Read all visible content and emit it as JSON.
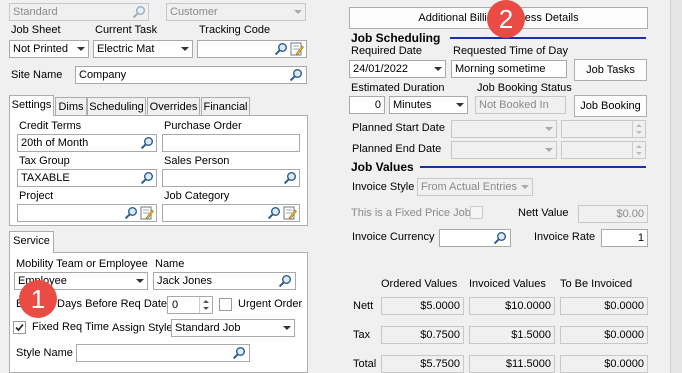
{
  "top": {
    "standard_value": "Standard",
    "customer_placeholder": "Customer"
  },
  "job_sheet": {
    "label": "Job Sheet",
    "value": "Not Printed"
  },
  "current_task": {
    "label": "Current Task",
    "value": "Electric Mat"
  },
  "tracking_code": {
    "label": "Tracking Code",
    "value": ""
  },
  "site_name": {
    "label": "Site Name",
    "value": "Company"
  },
  "tabs": [
    "Settings",
    "Dims",
    "Scheduling",
    "Overrides",
    "Financial"
  ],
  "settings": {
    "credit_terms_label": "Credit Terms",
    "credit_terms_value": "20th of Month",
    "purchase_order_label": "Purchase Order",
    "purchase_order_value": "",
    "tax_group_label": "Tax Group",
    "tax_group_value": "TAXABLE",
    "sales_person_label": "Sales Person",
    "sales_person_value": "",
    "project_label": "Project",
    "project_value": "",
    "job_category_label": "Job Category",
    "job_category_value": ""
  },
  "service": {
    "tab": "Service",
    "mobility_label": "Mobility Team or Employee",
    "mobility_value": "Employee",
    "name_label": "Name",
    "name_value": "Jack Jones",
    "days_before_label": "Days Before Req Date",
    "days_before_prefix": "B",
    "days_before_value": "0",
    "urgent_order_label": "Urgent Order",
    "fixed_req_time_label": "Fixed Req Time",
    "assign_style_label": "Assign Style",
    "assign_style_value": "Standard Job",
    "style_name_label": "Style Name",
    "style_name_value": ""
  },
  "billing_button": "Additional Billing Address Details",
  "job_scheduling": {
    "title": "Job Scheduling",
    "required_date_label": "Required Date",
    "required_date_value": "24/01/2022",
    "requested_time_label": "Requested Time of Day",
    "requested_time_value": "Morning sometime",
    "job_tasks_button": "Job Tasks",
    "estimated_duration_label": "Estimated Duration",
    "estimated_duration_value": "0",
    "duration_unit": "Minutes",
    "booking_status_label": "Job Booking Status",
    "booking_status_value": "Not Booked In",
    "job_booking_button": "Job Booking",
    "planned_start_label": "Planned Start Date",
    "planned_end_label": "Planned End Date"
  },
  "job_values": {
    "title": "Job Values",
    "invoice_style_label": "Invoice Style",
    "invoice_style_value": "From Actual Entries",
    "fixed_price_label": "This is a Fixed Price Job",
    "nett_value_label": "Nett Value",
    "nett_value": "$0.00",
    "invoice_currency_label": "Invoice Currency",
    "invoice_currency_value": "",
    "invoice_rate_label": "Invoice Rate",
    "invoice_rate_value": "1",
    "columns": [
      "Ordered Values",
      "Invoiced Values",
      "To Be Invoiced"
    ],
    "rows": [
      {
        "label": "Nett",
        "ordered": "$5.0000",
        "invoiced": "$10.0000",
        "to_invoice": "$0.0000"
      },
      {
        "label": "Tax",
        "ordered": "$0.7500",
        "invoiced": "$1.5000",
        "to_invoice": "$0.0000"
      },
      {
        "label": "Total",
        "ordered": "$5.7500",
        "invoiced": "$11.5000",
        "to_invoice": "$0.0000"
      }
    ]
  },
  "badges": {
    "one": "1",
    "two": "2"
  },
  "colors": {
    "accent_rule": "#1b2fa8",
    "badge": "#ea4b44"
  }
}
